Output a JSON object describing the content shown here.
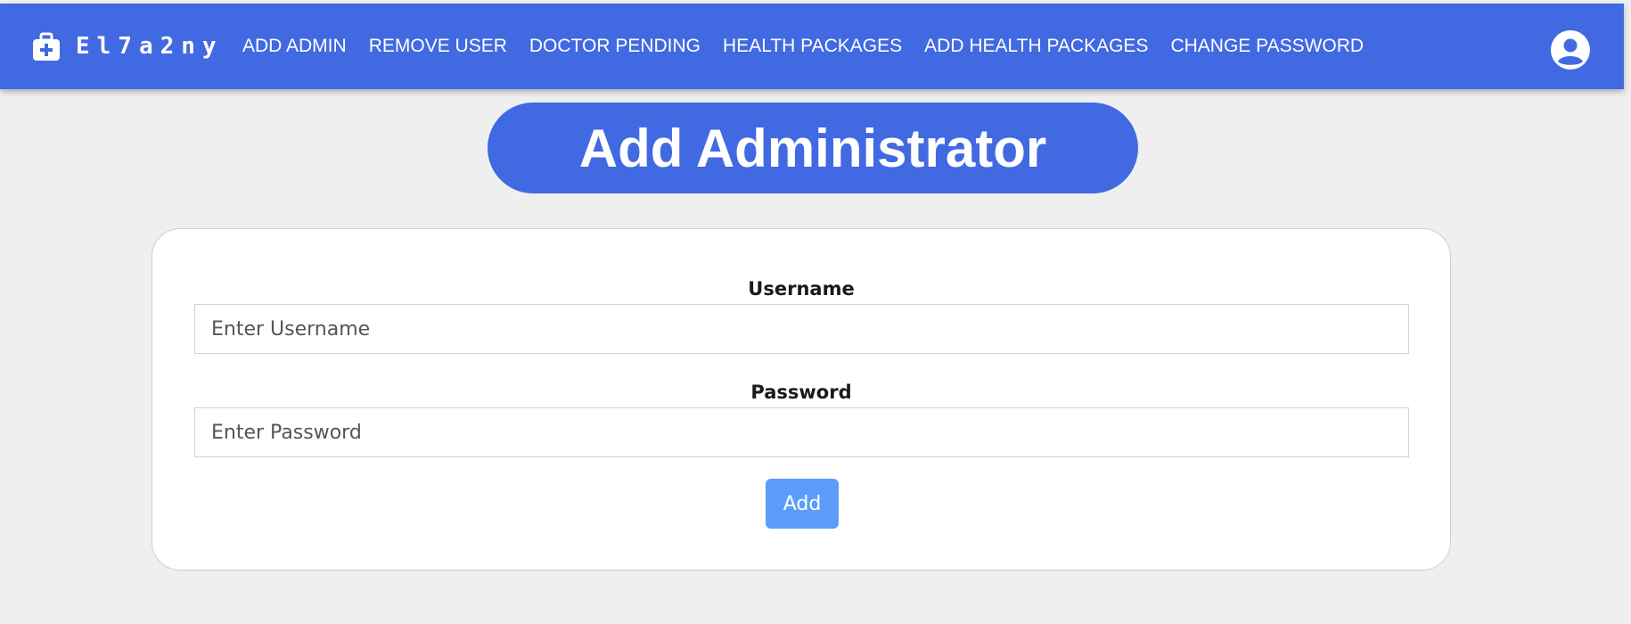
{
  "navbar": {
    "brand": {
      "icon": "medical-kit-icon",
      "name": "El7a2ny"
    },
    "links": [
      "ADD ADMIN",
      "REMOVE USER",
      "DOCTOR PENDING",
      "HEALTH PACKAGES",
      "ADD HEALTH PACKAGES",
      "CHANGE PASSWORD"
    ],
    "profile_icon": "account-circle-icon"
  },
  "page_title": "Add Administrator",
  "form": {
    "username": {
      "label": "Username",
      "placeholder": "Enter Username",
      "value": ""
    },
    "password": {
      "label": "Password",
      "placeholder": "Enter Password",
      "value": ""
    },
    "submit_label": "Add"
  },
  "colors": {
    "primary": "#4169e1",
    "button": "#5c9dfa",
    "background": "#efefef",
    "card": "#ffffff"
  }
}
